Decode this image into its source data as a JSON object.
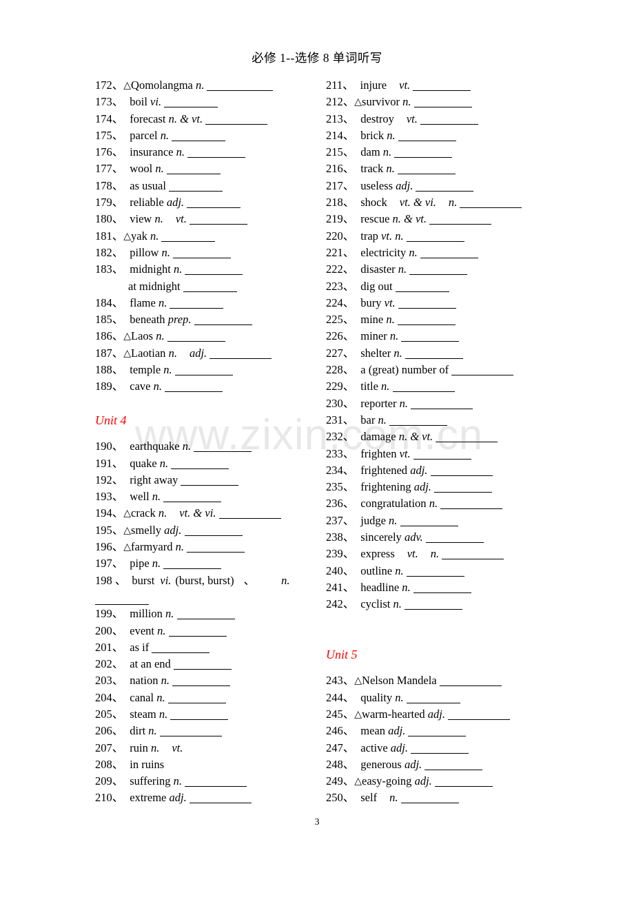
{
  "document": {
    "title": "必修 1--选修 8 单词听写",
    "page_number": "3",
    "watermark": "www.zixin.com.cn",
    "accent_color": "#ff0000",
    "text_color": "#000000"
  },
  "left_column": {
    "entries": [
      {
        "num": "172",
        "sep": "、",
        "marker": "△",
        "word": "Qomolangma",
        "pos": "n.",
        "blank": "b96"
      },
      {
        "num": "173",
        "sep": "、",
        "marker": "",
        "word": "boil",
        "pos": "vi.",
        "blank": "b78"
      },
      {
        "num": "174",
        "sep": "、",
        "marker": "",
        "word": "forecast",
        "pos": "n. & vt.",
        "blank": "b90"
      },
      {
        "num": "175",
        "sep": "、",
        "marker": "",
        "word": "parcel",
        "pos": "n.",
        "blank": "b78"
      },
      {
        "num": "176",
        "sep": "、",
        "marker": "",
        "word": "insurance",
        "pos": "n.",
        "blank": "b84"
      },
      {
        "num": "177",
        "sep": "、",
        "marker": "",
        "word": "wool",
        "pos": "n.",
        "blank": "b78"
      },
      {
        "num": "178",
        "sep": "、",
        "marker": "",
        "word": "as usual",
        "pos": "",
        "blank": "b78"
      },
      {
        "num": "179",
        "sep": "、",
        "marker": "",
        "word": "reliable",
        "pos": "adj.",
        "blank": "b78"
      },
      {
        "num": "180",
        "sep": "、",
        "marker": "",
        "word": "view",
        "pos": "n.",
        "pos2": "vt.",
        "blank": "b84"
      },
      {
        "num": "181",
        "sep": "、",
        "marker": "△",
        "word": "yak",
        "pos": "n.",
        "blank": "b78"
      },
      {
        "num": "182",
        "sep": "、",
        "marker": "",
        "word": "pillow",
        "pos": "n.",
        "blank": "b84"
      },
      {
        "num": "183",
        "sep": "、",
        "marker": "",
        "word": "midnight",
        "pos": "n.",
        "blank": "b84"
      },
      {
        "num": "",
        "sep": "",
        "marker": "",
        "word": "at midnight",
        "pos": "",
        "blank": "b78",
        "indent": true
      },
      {
        "num": "184",
        "sep": "、",
        "marker": "",
        "word": "flame",
        "pos": "n.",
        "blank": "b78"
      },
      {
        "num": "185",
        "sep": "、",
        "marker": "",
        "word": "beneath",
        "pos": "prep.",
        "blank": "b84"
      },
      {
        "num": "186",
        "sep": "、",
        "marker": "△",
        "word": "Laos",
        "pos": "n.",
        "blank": "b84"
      },
      {
        "num": "187",
        "sep": "、",
        "marker": "△",
        "word": "Laotian",
        "pos": "n.",
        "pos2": "adj.",
        "blank": "b90"
      },
      {
        "num": "188",
        "sep": "、",
        "marker": "",
        "word": "temple",
        "pos": "n.",
        "blank": "b84"
      },
      {
        "num": "189",
        "sep": "、",
        "marker": "",
        "word": "cave",
        "pos": "n.",
        "blank": "b84"
      }
    ],
    "unit_heading": "Unit 4",
    "entries2": [
      {
        "num": "190",
        "sep": "、",
        "marker": "",
        "word": "earthquake",
        "pos": "n.",
        "blank": "b84"
      },
      {
        "num": "191",
        "sep": "、",
        "marker": "",
        "word": "quake",
        "pos": "n.",
        "blank": "b84"
      },
      {
        "num": "192",
        "sep": "、",
        "marker": "",
        "word": "right away",
        "pos": "",
        "blank": "b84"
      },
      {
        "num": "193",
        "sep": "、",
        "marker": "",
        "word": "well",
        "pos": "n.",
        "blank": "b84"
      },
      {
        "num": "194",
        "sep": "、",
        "marker": "△",
        "word": "crack",
        "pos": "n.",
        "pos2": "vt. & vi.",
        "blank": "b90"
      },
      {
        "num": "195",
        "sep": "、",
        "marker": "△",
        "word": "smelly",
        "pos": "adj.",
        "blank": "b84"
      },
      {
        "num": "196",
        "sep": "、",
        "marker": "△",
        "word": "farmyard",
        "pos": "n.",
        "blank": "b84"
      },
      {
        "num": "197",
        "sep": "、",
        "marker": "",
        "word": "pipe",
        "pos": "n.",
        "blank": "b84"
      }
    ],
    "entry_198": {
      "num": "198",
      "sep": "、",
      "word": "burst",
      "pos": "vi.",
      "detail": "(burst, burst)",
      "sep2": "、",
      "pos2": "n.",
      "blank": "b78"
    },
    "entries3": [
      {
        "num": "199",
        "sep": "、",
        "marker": "",
        "word": "million",
        "pos": "n.",
        "blank": "b84"
      },
      {
        "num": "200",
        "sep": "、",
        "marker": "",
        "word": "event",
        "pos": "n.",
        "blank": "b84"
      },
      {
        "num": "201",
        "sep": "、",
        "marker": "",
        "word": "as if",
        "pos": "",
        "blank": "b84"
      },
      {
        "num": "202",
        "sep": "、",
        "marker": "",
        "word": "at an end",
        "pos": "",
        "blank": "b84"
      },
      {
        "num": "203",
        "sep": "、",
        "marker": "",
        "word": "nation",
        "pos": "n.",
        "blank": "b84"
      },
      {
        "num": "204",
        "sep": "、",
        "marker": "",
        "word": "canal",
        "pos": "n.",
        "blank": "b84"
      },
      {
        "num": "205",
        "sep": "、",
        "marker": "",
        "word": "steam",
        "pos": "n.",
        "blank": "b84"
      },
      {
        "num": "206",
        "sep": "、",
        "marker": "",
        "word": "dirt",
        "pos": "n.",
        "blank": "b90"
      },
      {
        "num": "207",
        "sep": "、",
        "marker": "",
        "word": "ruin",
        "pos": "n.",
        "pos2": "vt.",
        "blank": ""
      },
      {
        "num": "208",
        "sep": "、",
        "marker": "",
        "word": "in ruins",
        "pos": "",
        "blank": ""
      },
      {
        "num": "209",
        "sep": "、",
        "marker": "",
        "word": "suffering",
        "pos": "n.",
        "blank": "b90"
      },
      {
        "num": "210",
        "sep": "、",
        "marker": "",
        "word": "extreme",
        "pos": "adj.",
        "blank": "b90"
      }
    ]
  },
  "right_column": {
    "entries": [
      {
        "num": "211",
        "sep": "、",
        "marker": "",
        "word": "injure",
        "pos": "",
        "pos2": "vt.",
        "blank": "b84"
      },
      {
        "num": "212",
        "sep": "、",
        "marker": "△",
        "word": "survivor",
        "pos": "n.",
        "blank": "b84"
      },
      {
        "num": "213",
        "sep": "、",
        "marker": "",
        "word": "destroy",
        "pos": "",
        "pos2": "vt.",
        "blank": "b84"
      },
      {
        "num": "214",
        "sep": "、",
        "marker": "",
        "word": "brick",
        "pos": "n.",
        "blank": "b84"
      },
      {
        "num": "215",
        "sep": "、",
        "marker": "",
        "word": "dam",
        "pos": "n.",
        "blank": "b84"
      },
      {
        "num": "216",
        "sep": "、",
        "marker": "",
        "word": "track",
        "pos": "n.",
        "blank": "b84"
      },
      {
        "num": "217",
        "sep": "、",
        "marker": "",
        "word": "useless",
        "pos": "adj.",
        "blank": "b84"
      },
      {
        "num": "218",
        "sep": "、",
        "marker": "",
        "word": "shock",
        "pos": "",
        "pos2": "vt. & vi.",
        "pos3": "n.",
        "blank": "b90"
      },
      {
        "num": "219",
        "sep": "、",
        "marker": "",
        "word": "rescue",
        "pos": "n. & vt.",
        "blank": "b90"
      },
      {
        "num": "220",
        "sep": "、",
        "marker": "",
        "word": "trap",
        "pos": "vt. n.",
        "blank": "b84"
      },
      {
        "num": "221",
        "sep": "、",
        "marker": "",
        "word": "electricity",
        "pos": "n.",
        "blank": "b84"
      },
      {
        "num": "222",
        "sep": "、",
        "marker": "",
        "word": "disaster",
        "pos": "n.",
        "blank": "b84"
      },
      {
        "num": "223",
        "sep": "、",
        "marker": "",
        "word": "dig out",
        "pos": "",
        "blank": "b78"
      },
      {
        "num": "224",
        "sep": "、",
        "marker": "",
        "word": "bury",
        "pos": "vt.",
        "blank": "b84"
      },
      {
        "num": "225",
        "sep": "、",
        "marker": "",
        "word": "mine",
        "pos": "n.",
        "blank": "b84"
      },
      {
        "num": "226",
        "sep": "、",
        "marker": "",
        "word": "miner",
        "pos": "n.",
        "blank": "b84"
      },
      {
        "num": "227",
        "sep": "、",
        "marker": "",
        "word": "shelter",
        "pos": "n.",
        "blank": "b84"
      },
      {
        "num": "228",
        "sep": "、",
        "marker": "",
        "word": "a (great) number of",
        "pos": "",
        "blank": "b90"
      },
      {
        "num": "229",
        "sep": "、",
        "marker": "",
        "word": "title",
        "pos": "n.",
        "blank": "b90"
      },
      {
        "num": "230",
        "sep": "、",
        "marker": "",
        "word": "reporter",
        "pos": "n.",
        "blank": "b90"
      },
      {
        "num": "231",
        "sep": "、",
        "marker": "",
        "word": "bar",
        "pos": "n.",
        "blank": "b84"
      },
      {
        "num": "232",
        "sep": "、",
        "marker": "",
        "word": "damage",
        "pos": "n. & vt.",
        "blank": "b90"
      },
      {
        "num": "233",
        "sep": "、",
        "marker": "",
        "word": "frighten",
        "pos": "vt.",
        "blank": "b84"
      },
      {
        "num": "234",
        "sep": "、",
        "marker": "",
        "word": "frightened",
        "pos": "adj.",
        "blank": "b90"
      },
      {
        "num": "235",
        "sep": "、",
        "marker": "",
        "word": "frightening",
        "pos": "adj.",
        "blank": "b84"
      },
      {
        "num": "236",
        "sep": "、",
        "marker": "",
        "word": "congratulation",
        "pos": "n.",
        "blank": "b90"
      },
      {
        "num": "237",
        "sep": "、",
        "marker": "",
        "word": "judge",
        "pos": "n.",
        "blank": "b84"
      },
      {
        "num": "238",
        "sep": "、",
        "marker": "",
        "word": "sincerely",
        "pos": "adv.",
        "blank": "b84"
      },
      {
        "num": "239",
        "sep": "、",
        "marker": "",
        "word": "express",
        "pos": "",
        "pos2": "vt.",
        "pos3": "n.",
        "blank": "b90"
      },
      {
        "num": "240",
        "sep": "、",
        "marker": "",
        "word": "outline",
        "pos": "n.",
        "blank": "b84"
      },
      {
        "num": "241",
        "sep": "、",
        "marker": "",
        "word": "headline",
        "pos": "n.",
        "blank": "b84"
      },
      {
        "num": "242",
        "sep": "、",
        "marker": "",
        "word": "cyclist",
        "pos": "n.",
        "blank": "b84"
      }
    ],
    "unit_heading": "Unit 5",
    "entries2": [
      {
        "num": "243",
        "sep": "、",
        "marker": "△",
        "word": "Nelson Mandela",
        "pos": "",
        "blank": "b90"
      },
      {
        "num": "244",
        "sep": "、",
        "marker": "",
        "word": "quality",
        "pos": "n.",
        "blank": "b78"
      },
      {
        "num": "245",
        "sep": "、",
        "marker": "△",
        "word": "warm-hearted",
        "pos": "adj.",
        "blank": "b90"
      },
      {
        "num": "246",
        "sep": "、",
        "marker": "",
        "word": "mean",
        "pos": "adj.",
        "blank": "b84"
      },
      {
        "num": "247",
        "sep": "、",
        "marker": "",
        "word": "active",
        "pos": "adj.",
        "blank": "b84"
      },
      {
        "num": "248",
        "sep": "、",
        "marker": "",
        "word": "generous",
        "pos": "adj.",
        "blank": "b84"
      },
      {
        "num": "249",
        "sep": "、",
        "marker": "△",
        "word": "easy-going",
        "pos": "adj.",
        "blank": "b84"
      },
      {
        "num": "250",
        "sep": "、",
        "marker": "",
        "word": "self",
        "pos": "",
        "pos2": "n.",
        "blank": "b84"
      }
    ]
  }
}
